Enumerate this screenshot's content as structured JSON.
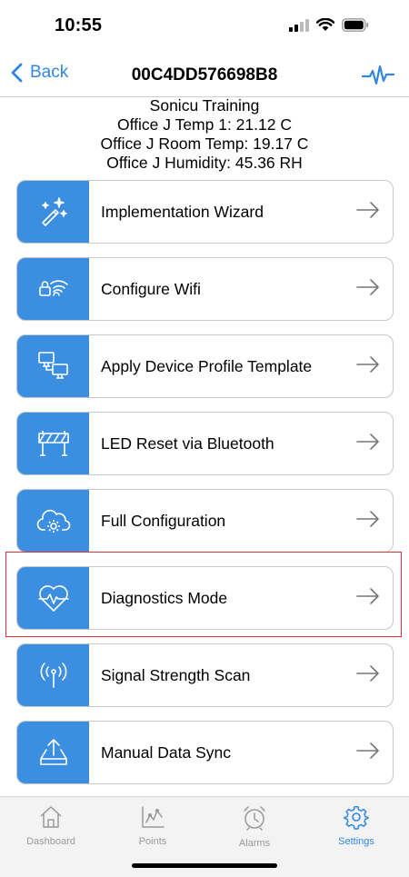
{
  "status": {
    "time": "10:55"
  },
  "nav": {
    "back_label": "Back",
    "title": "00C4DD576698B8"
  },
  "info": {
    "lines": [
      "Sonicu Training",
      "Office J Temp 1: 21.12 C",
      "Office J Room Temp: 19.17 C",
      "Office J Humidity: 45.36 RH"
    ]
  },
  "menu": {
    "items": [
      {
        "label": "Implementation Wizard",
        "icon": "magic-wand-icon"
      },
      {
        "label": "Configure Wifi",
        "icon": "wifi-lock-icon"
      },
      {
        "label": "Apply Device Profile Template",
        "icon": "computers-icon"
      },
      {
        "label": "LED Reset via Bluetooth",
        "icon": "barricade-icon"
      },
      {
        "label": "Full Configuration",
        "icon": "cloud-gear-icon"
      },
      {
        "label": "Diagnostics Mode",
        "icon": "heart-pulse-icon"
      },
      {
        "label": "Signal Strength Scan",
        "icon": "antenna-icon"
      },
      {
        "label": "Manual Data Sync",
        "icon": "upload-tray-icon"
      }
    ]
  },
  "tabs": [
    {
      "label": "Dashboard",
      "icon": "home-icon"
    },
    {
      "label": "Points",
      "icon": "chart-icon"
    },
    {
      "label": "Alarms",
      "icon": "alarm-clock-icon"
    },
    {
      "label": "Settings",
      "icon": "gear-icon"
    }
  ],
  "colors": {
    "accent": "#3b8ee0",
    "link": "#2f86e3",
    "highlight": "#e0303a"
  }
}
